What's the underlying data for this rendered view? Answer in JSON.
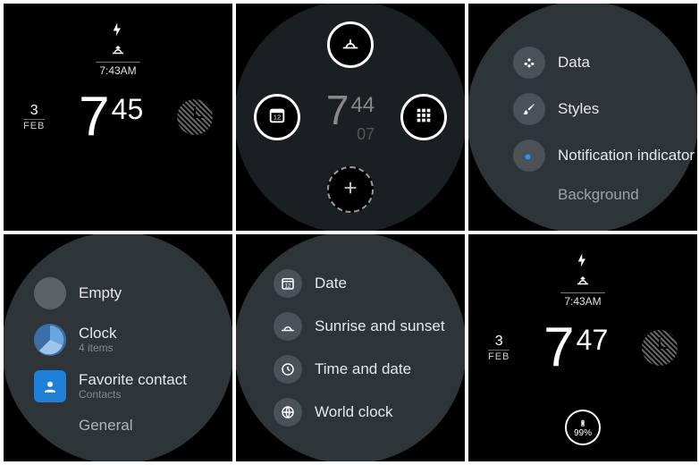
{
  "watchface1": {
    "sunrise_time": "7:43AM",
    "date_day": "3",
    "date_mon": "FEB",
    "time_hour": "7",
    "time_min": "45"
  },
  "editor": {
    "preview_hour": "7",
    "preview_min": "44",
    "preview_sec": "07"
  },
  "settings_menu": {
    "item1": "Data",
    "item2": "Styles",
    "item3": "Notification indicator",
    "item4": "Background"
  },
  "data_source_menu": {
    "empty": "Empty",
    "clock_label": "Clock",
    "clock_sub": "4 items",
    "fav_label": "Favorite contact",
    "fav_sub": "Contacts",
    "general": "General"
  },
  "clock_submenu": {
    "date": "Date",
    "sunrise": "Sunrise and sunset",
    "timedate": "Time and date",
    "worldclock": "World clock"
  },
  "watchface2": {
    "sunrise_time": "7:43AM",
    "date_day": "3",
    "date_mon": "FEB",
    "time_hour": "7",
    "time_min": "47",
    "battery": "99%"
  }
}
